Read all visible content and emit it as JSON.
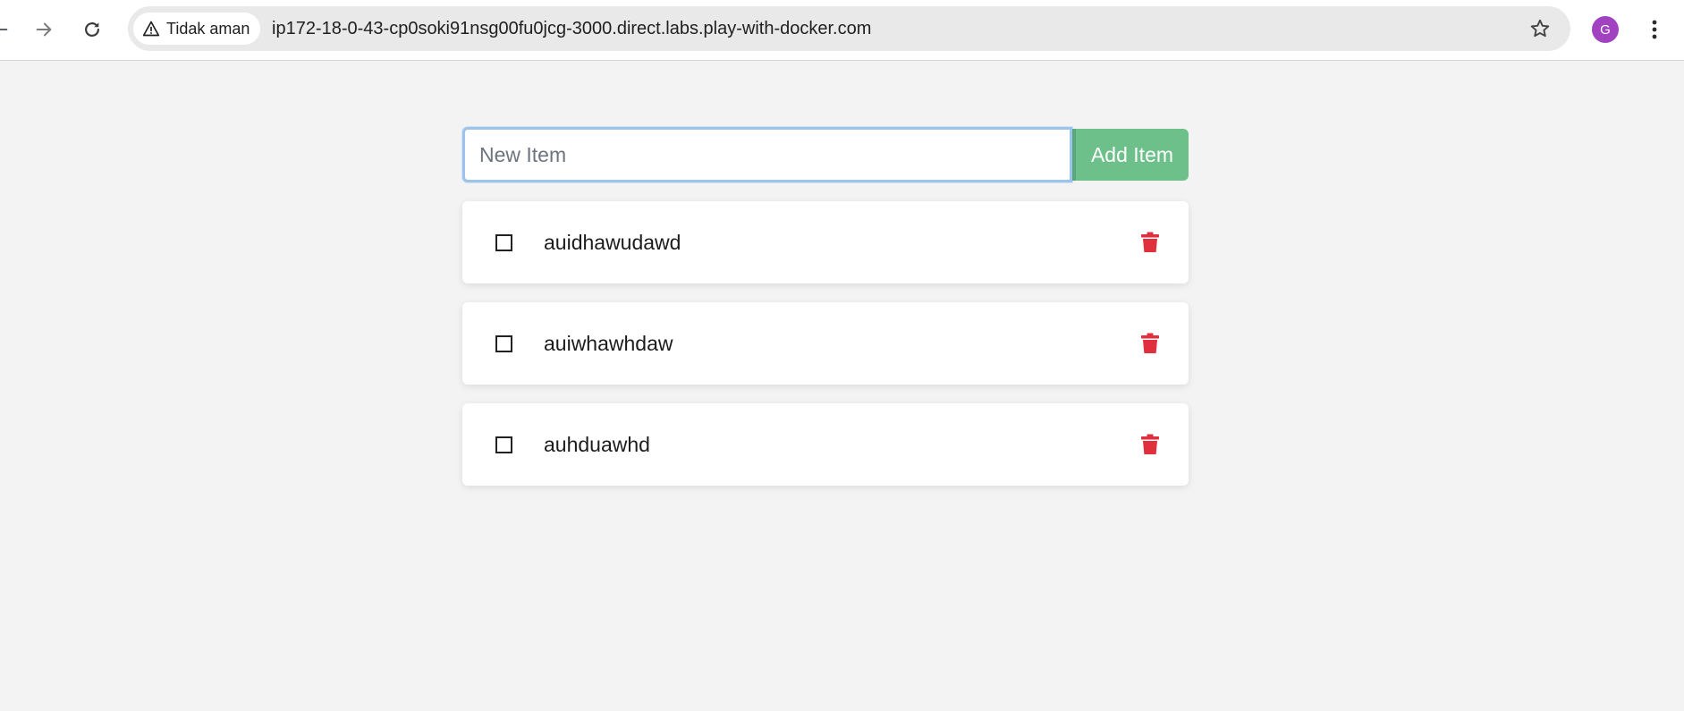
{
  "browser": {
    "security_label": "Tidak aman",
    "url": "ip172-18-0-43-cp0soki91nsg00fu0jcg-3000.direct.labs.play-with-docker.com",
    "profile_initial": "G"
  },
  "form": {
    "placeholder": "New Item",
    "value": "",
    "add_label": "Add Item"
  },
  "items": [
    {
      "name": "auidhawudawd",
      "completed": false
    },
    {
      "name": "auiwhawhdaw",
      "completed": false
    },
    {
      "name": "auhduawhd",
      "completed": false
    }
  ],
  "colors": {
    "page_background": "#f3f3f3",
    "add_button": "#6ec08a",
    "delete_icon": "#e0303d",
    "input_focus_border": "#9cc3ea",
    "avatar": "#a142c0"
  },
  "icons": {
    "back": "arrow-left-icon",
    "forward": "arrow-right-icon",
    "reload": "reload-icon",
    "security": "warning-triangle-icon",
    "bookmark": "star-icon",
    "menu": "kebab-menu-icon",
    "checkbox": "checkbox-icon",
    "delete": "trash-icon"
  }
}
